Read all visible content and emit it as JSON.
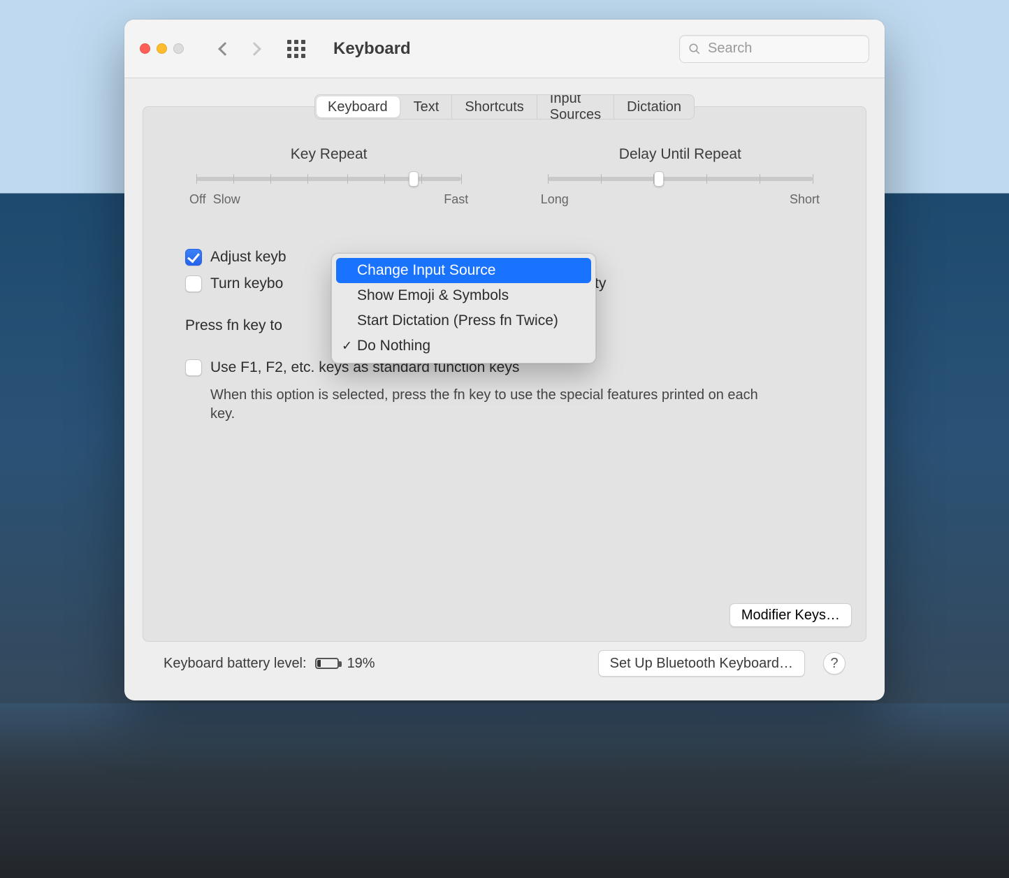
{
  "header": {
    "title": "Keyboard",
    "search_placeholder": "Search"
  },
  "tabs": {
    "items": [
      "Keyboard",
      "Text",
      "Shortcuts",
      "Input Sources",
      "Dictation"
    ],
    "active_index": 0
  },
  "sliders": {
    "key_repeat": {
      "label": "Key Repeat",
      "left_caption": "Off",
      "left_caption2": "Slow",
      "right_caption": "Fast",
      "ticks": 8,
      "knob_percent": 82
    },
    "delay": {
      "label": "Delay Until Repeat",
      "left_caption": "Long",
      "right_caption": "Short",
      "ticks": 6,
      "knob_percent": 42
    }
  },
  "options": {
    "adjust_brightness": {
      "checked": true,
      "label_visible": "Adjust keyb"
    },
    "backlight_off": {
      "checked": false,
      "label_visible": "Turn keybo",
      "label_tail": "f inactivity"
    },
    "press_fn_label": "Press fn key to",
    "fn_keys": {
      "checked": false,
      "label": "Use F1, F2, etc. keys as standard function keys",
      "desc": "When this option is selected, press the fn key to use the special features printed on each key."
    }
  },
  "popup": {
    "items": [
      {
        "label": "Change Input Source",
        "highlighted": true,
        "checked": false
      },
      {
        "label": "Show Emoji & Symbols",
        "highlighted": false,
        "checked": false
      },
      {
        "label": "Start Dictation (Press fn Twice)",
        "highlighted": false,
        "checked": false
      },
      {
        "label": "Do Nothing",
        "highlighted": false,
        "checked": true
      }
    ]
  },
  "buttons": {
    "modifier": "Modifier Keys…",
    "bluetooth": "Set Up Bluetooth Keyboard…",
    "help": "?"
  },
  "footer": {
    "battery_label": "Keyboard battery level:",
    "battery_percent": "19%"
  }
}
